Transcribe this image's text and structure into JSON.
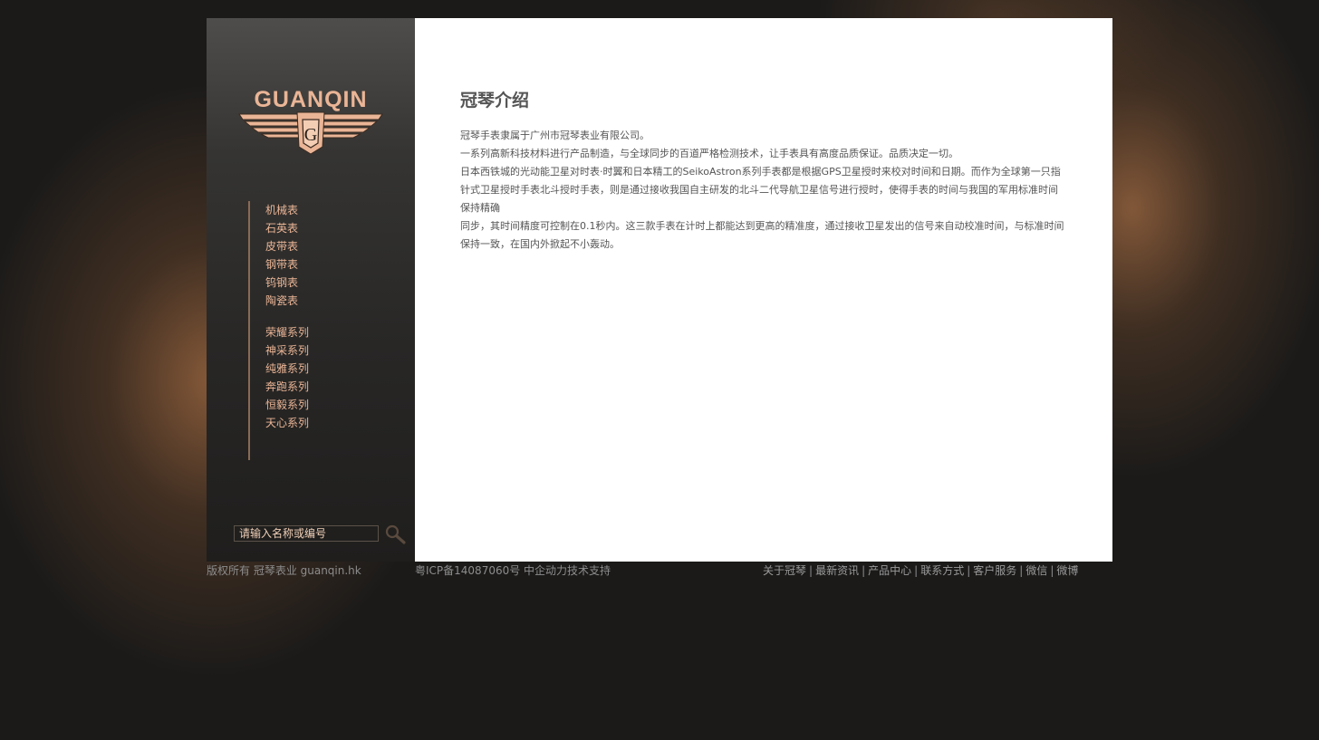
{
  "brand": {
    "logo_text": "GUANQIN",
    "logo_emblem_letter": "G",
    "accent_color": "#eab596"
  },
  "nav": {
    "group1": [
      {
        "label": "机械表"
      },
      {
        "label": "石英表"
      },
      {
        "label": "皮带表"
      },
      {
        "label": "钢带表"
      },
      {
        "label": "钨钢表"
      },
      {
        "label": "陶瓷表"
      }
    ],
    "group2": [
      {
        "label": "荣耀系列"
      },
      {
        "label": "神采系列"
      },
      {
        "label": "纯雅系列"
      },
      {
        "label": "奔跑系列"
      },
      {
        "label": "恒毅系列"
      },
      {
        "label": "天心系列"
      }
    ]
  },
  "search": {
    "placeholder": "请输入名称或编号",
    "icon": "magnifier-icon"
  },
  "content": {
    "title": "冠琴介绍",
    "paragraphs": [
      "冠琴手表隶属于广州市冠琴表业有限公司。",
      "一系列高新科技材料进行产品制造，与全球同步的百道严格检测技术，让手表具有高度品质保证。品质决定一切。",
      "日本西铁城的光动能卫星对时表·时翼和日本精工的SeikoAstron系列手表都是根据GPS卫星授时来校对时间和日期。而作为全球第一只指针式卫星授时手表北斗授时手表，则是通过接收我国自主研发的北斗二代导航卫星信号进行授时，使得手表的时间与我国的军用标准时间保持精确",
      "同步，其时间精度可控制在0.1秒内。这三款手表在计时上都能达到更高的精准度，通过接收卫星发出的信号来自动校准时间，与标准时间保持一致，在国内外掀起不小轰动。"
    ]
  },
  "footer": {
    "copyright": "版权所有 冠琴表业 guanqin.hk",
    "icp": "粤ICP备14087060号 中企动力技术支持",
    "links": [
      {
        "label": "关于冠琴"
      },
      {
        "label": "最新资讯"
      },
      {
        "label": "产品中心"
      },
      {
        "label": "联系方式"
      },
      {
        "label": "客户服务"
      },
      {
        "label": "微信"
      },
      {
        "label": "微博"
      }
    ],
    "separator": "|"
  }
}
